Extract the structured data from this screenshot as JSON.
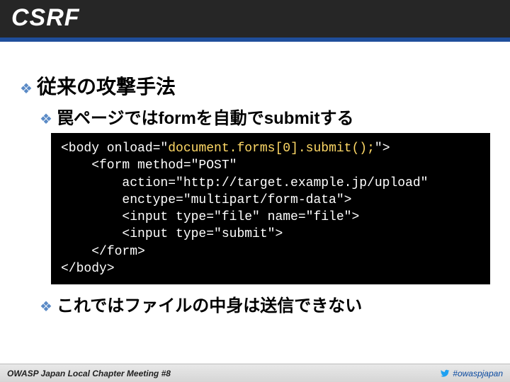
{
  "title": "CSRF",
  "bullets": {
    "l1": "従来の攻撃手法",
    "l2a": "罠ページではformを自動でsubmitする",
    "l2b": "これではファイルの中身は送信できない"
  },
  "code": {
    "p1": "<body onload=\"",
    "hl": "document.forms[0].submit();",
    "p2": "\">\n    <form method=\"POST\" \n        action=\"http://target.example.jp/upload\"\n        enctype=\"multipart/form-data\">\n        <input type=\"file\" name=\"file\">\n        <input type=\"submit\">\n    </form>\n</body>"
  },
  "footer": {
    "left": "OWASP Japan Local Chapter Meeting #8",
    "right": "#owaspjapan"
  }
}
